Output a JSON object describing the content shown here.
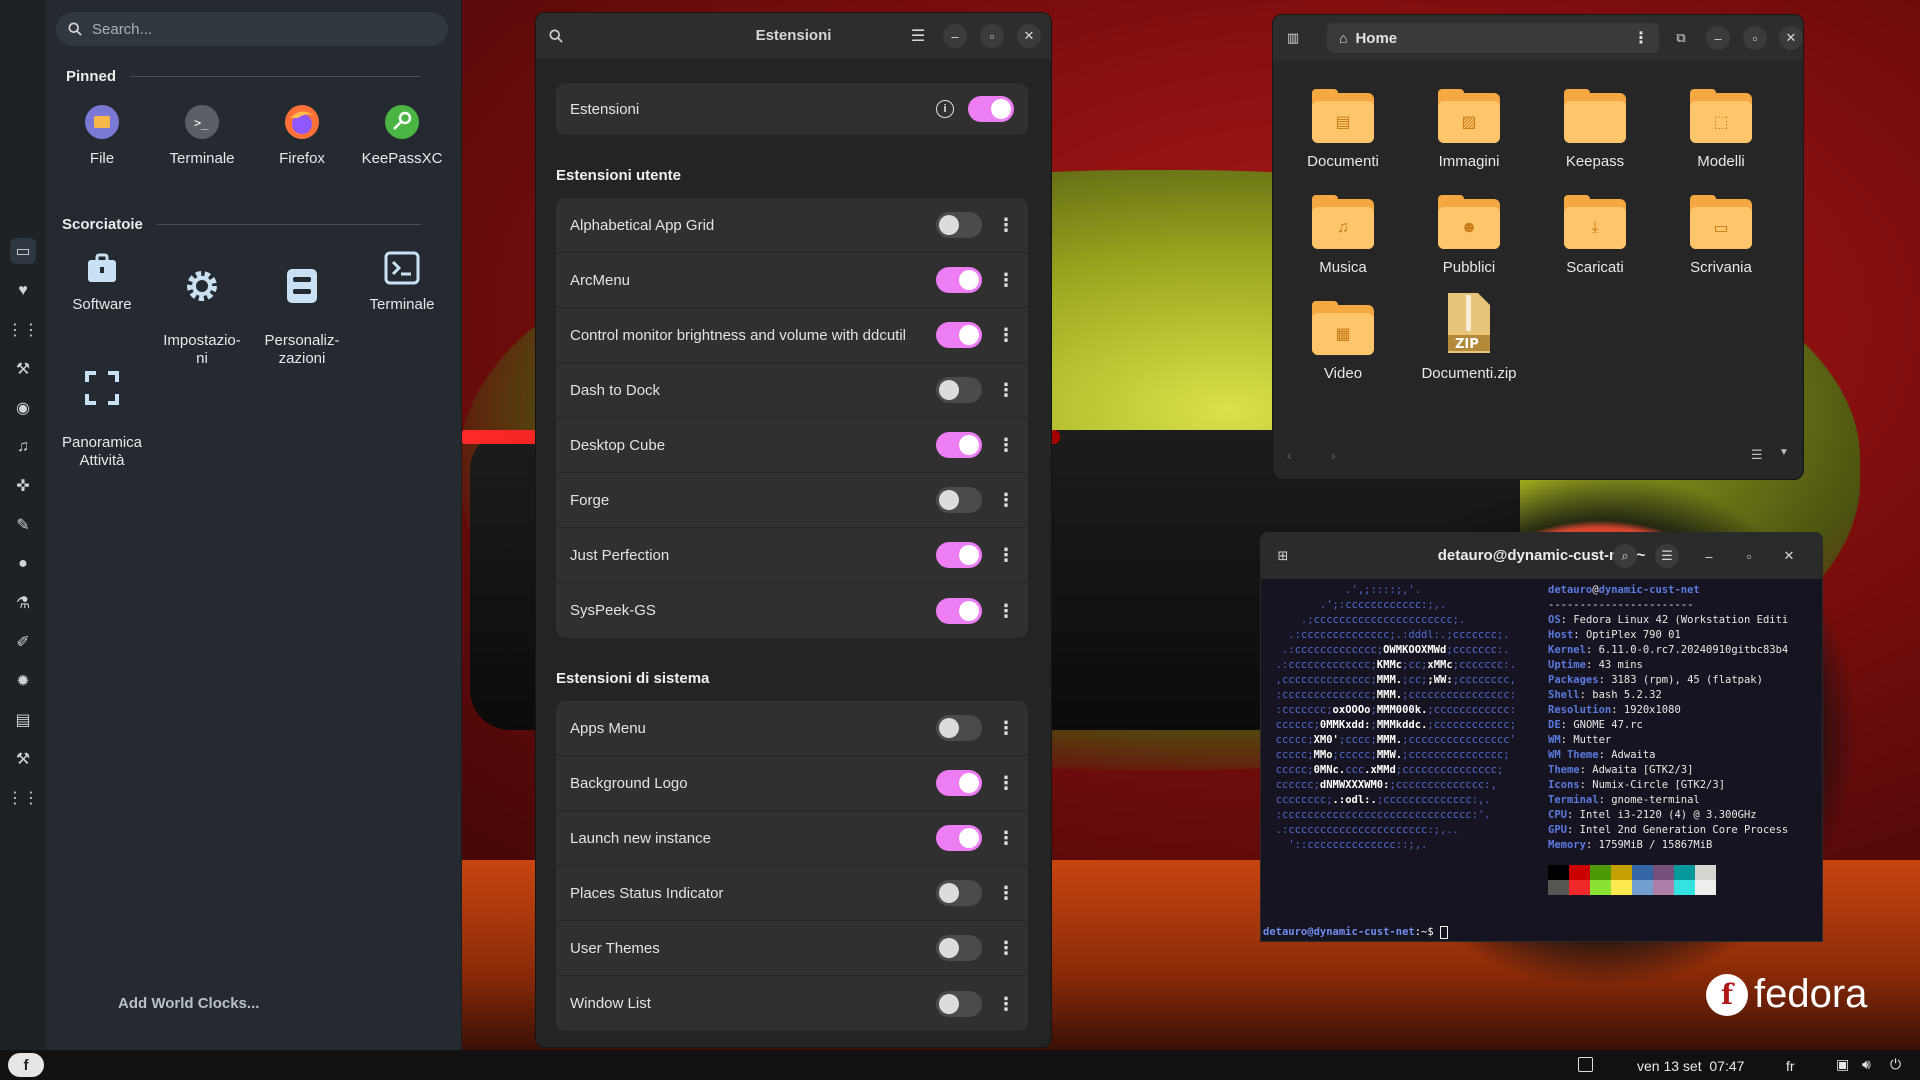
{
  "app_menu": {
    "search_placeholder": "Search...",
    "pinned_title": "Pinned",
    "pinned": [
      {
        "label": "File"
      },
      {
        "label": "Terminale"
      },
      {
        "label": "Firefox"
      },
      {
        "label": "KeePassXC"
      }
    ],
    "shortcuts_title": "Scorciatoie",
    "shortcuts": [
      {
        "label": "Software"
      },
      {
        "label": "Impostazio-\nni"
      },
      {
        "label": "Personaliz-\nzazioni"
      },
      {
        "label": "Terminale"
      },
      {
        "label": "Panoramica\nAttività"
      }
    ],
    "world_clocks": "Add World Clocks..."
  },
  "extensions": {
    "window_title": "Estensioni",
    "master_label": "Estensioni",
    "master_on": true,
    "user_title": "Estensioni utente",
    "user_items": [
      {
        "name": "Alphabetical App Grid",
        "on": false
      },
      {
        "name": "ArcMenu",
        "on": true
      },
      {
        "name": "Control monitor brightness and volume with ddcutil",
        "on": true
      },
      {
        "name": "Dash to Dock",
        "on": false
      },
      {
        "name": "Desktop Cube",
        "on": true
      },
      {
        "name": "Forge",
        "on": false
      },
      {
        "name": "Just Perfection",
        "on": true
      },
      {
        "name": "SysPeek-GS",
        "on": true
      }
    ],
    "system_title": "Estensioni di sistema",
    "system_items": [
      {
        "name": "Apps Menu",
        "on": false
      },
      {
        "name": "Background Logo",
        "on": true
      },
      {
        "name": "Launch new instance",
        "on": true
      },
      {
        "name": "Places Status Indicator",
        "on": false
      },
      {
        "name": "User Themes",
        "on": false
      },
      {
        "name": "Window List",
        "on": false
      }
    ]
  },
  "files": {
    "location": "Home",
    "folders": [
      {
        "name": "Documenti",
        "icon": "document-icon"
      },
      {
        "name": "Immagini",
        "icon": "image-icon"
      },
      {
        "name": "Keepass",
        "icon": "folder-icon"
      },
      {
        "name": "Modelli",
        "icon": "template-icon"
      },
      {
        "name": "Musica",
        "icon": "music-icon"
      },
      {
        "name": "Pubblici",
        "icon": "people-icon"
      },
      {
        "name": "Scaricati",
        "icon": "download-icon"
      },
      {
        "name": "Scrivania",
        "icon": "desktop-icon"
      },
      {
        "name": "Video",
        "icon": "video-icon"
      },
      {
        "name": "Documenti.zip",
        "icon": "zip-icon"
      }
    ]
  },
  "terminal": {
    "title": "detauro@dynamic-cust-net:~",
    "user": "detauro",
    "host": "dynamic-cust-net",
    "separator": "-----------------------",
    "info": [
      {
        "k": "OS",
        "v": "Fedora Linux 42 (Workstation Editi"
      },
      {
        "k": "Host",
        "v": "OptiPlex 790 01"
      },
      {
        "k": "Kernel",
        "v": "6.11.0-0.rc7.20240910gitbc83b4"
      },
      {
        "k": "Uptime",
        "v": "43 mins"
      },
      {
        "k": "Packages",
        "v": "3183 (rpm), 45 (flatpak)"
      },
      {
        "k": "Shell",
        "v": "bash 5.2.32"
      },
      {
        "k": "Resolution",
        "v": "1920x1080"
      },
      {
        "k": "DE",
        "v": "GNOME 47.rc"
      },
      {
        "k": "WM",
        "v": "Mutter"
      },
      {
        "k": "WM Theme",
        "v": "Adwaita"
      },
      {
        "k": "Theme",
        "v": "Adwaita [GTK2/3]"
      },
      {
        "k": "Icons",
        "v": "Numix-Circle [GTK2/3]"
      },
      {
        "k": "Terminal",
        "v": "gnome-terminal"
      },
      {
        "k": "CPU",
        "v": "Intel i3-2120 (4) @ 3.300GHz"
      },
      {
        "k": "GPU",
        "v": "Intel 2nd Generation Core Process"
      },
      {
        "k": "Memory",
        "v": "1759MiB / 15867MiB"
      }
    ],
    "palette": [
      "#000000",
      "#cc0000",
      "#4e9a06",
      "#c4a000",
      "#3465a4",
      "#75507b",
      "#06989a",
      "#d3d7cf",
      "#555753",
      "#ef2929",
      "#8ae234",
      "#fce94f",
      "#729fcf",
      "#ad7fa8",
      "#34e2e2",
      "#eeeeec"
    ],
    "prompt": "detauro@dynamic-cust-net",
    "prompt_suffix": ":~$ "
  },
  "wallpaper_logo": "fedora",
  "panel": {
    "datetime": "ven 13 set  07:47",
    "keyboard": "fr"
  }
}
